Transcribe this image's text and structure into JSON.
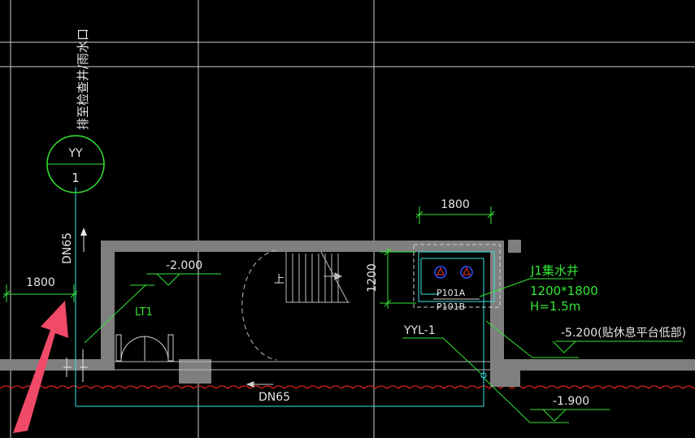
{
  "drawing": {
    "riser_tag": {
      "top": "YY",
      "bottom": "1"
    },
    "riser_note": "排至检查井/雨水口",
    "pipe_size_vertical": "DN65",
    "pipe_size_horizontal": "DN65",
    "dim_left": "1800",
    "dim_top": "1800",
    "dim_vertical": "1200",
    "elevation_room": "-2.000",
    "elevation_pit": "-5.200(贴休息平台低部)",
    "elevation_outside": "-1.900",
    "pit_label": "J1集水井",
    "pit_size": "1200*1800",
    "pit_depth": "H=1.5m",
    "pump_a": "P101A",
    "pump_b": "P101B",
    "riser_label": "YYL-1",
    "stair_label": "LT1",
    "stair_up_label": "上"
  },
  "colors": {
    "background": "#000000",
    "wall": "#808080",
    "annotation": "#33e633",
    "pipe": "#39e6e6",
    "text": "#e6e6e6",
    "grid": "#d0d0d0",
    "wave": "#e02020",
    "arrow": "#f04060"
  }
}
